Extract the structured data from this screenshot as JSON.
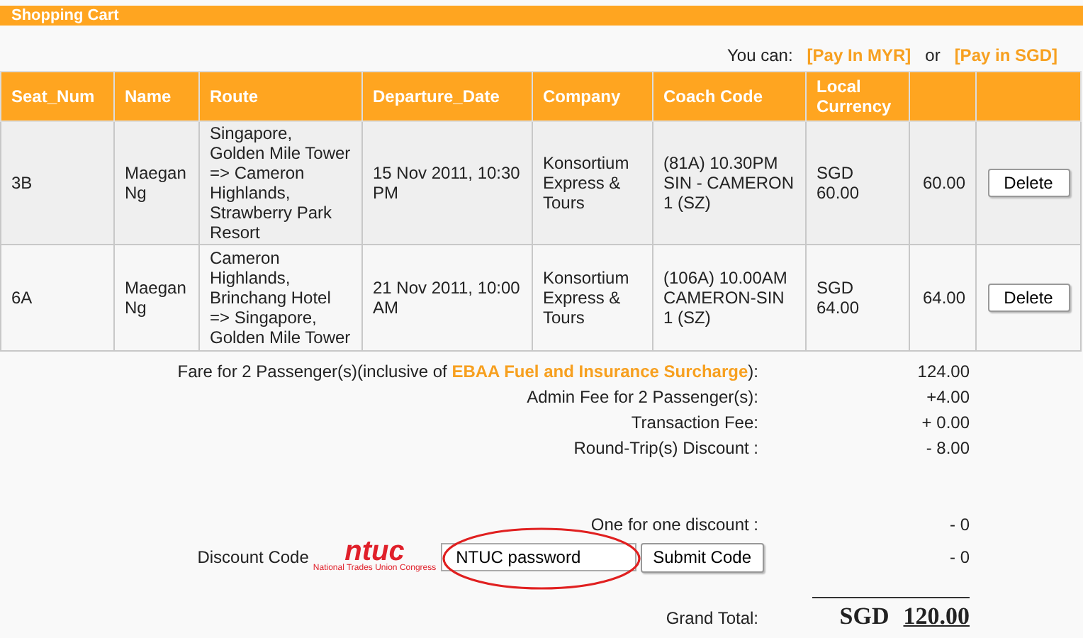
{
  "header": {
    "title": "Shopping Cart"
  },
  "pay_options": {
    "prompt": "You can:",
    "links": [
      "[Pay In MYR]",
      "[Pay in SGD]"
    ],
    "separator": "or"
  },
  "table": {
    "columns": [
      "Seat_Num",
      "Name",
      "Route",
      "Departure_Date",
      "Company",
      "Coach Code",
      "Local Currency"
    ],
    "rows": [
      {
        "seat": "3B",
        "name": "Maegan Ng",
        "route": "Singapore, Golden Mile Tower => Cameron Highlands, Strawberry Park Resort",
        "departure": "15 Nov 2011, 10:30 PM",
        "company": "Konsortium Express & Tours",
        "coach_code": "(81A) 10.30PM SIN - CAMERON 1 (SZ)",
        "local_currency": "SGD 60.00",
        "amount": "60.00",
        "action": "Delete"
      },
      {
        "seat": "6A",
        "name": "Maegan Ng",
        "route": "Cameron Highlands, Brinchang Hotel => Singapore, Golden Mile Tower",
        "departure": "21 Nov 2011, 10:00 AM",
        "company": "Konsortium Express & Tours",
        "coach_code": "(106A) 10.00AM CAMERON-SIN 1 (SZ)",
        "local_currency": "SGD 64.00",
        "amount": "64.00",
        "action": "Delete"
      }
    ]
  },
  "fare": {
    "prefix": "Fare for 2 Passenger(s)(inclusive of ",
    "link": "EBAA Fuel and Insurance Surcharge",
    "suffix": "):",
    "value": "124.00"
  },
  "charges": [
    {
      "label": "Admin Fee for 2 Passenger(s):",
      "value": "+4.00"
    },
    {
      "label": "Transaction Fee:",
      "value": "+ 0.00"
    },
    {
      "label": "Round-Trip(s) Discount :",
      "value": "- 8.00"
    }
  ],
  "one_for_one": {
    "label": "One for one discount :",
    "value": "- 0"
  },
  "discount_code": {
    "label": "Discount Code",
    "logo_text": "ntuc",
    "logo_tagline": "National Trades Union Congress",
    "input_value": "NTUC password",
    "button": "Submit Code",
    "value": "- 0"
  },
  "grand_total": {
    "label": "Grand Total:",
    "currency": "SGD",
    "amount": "120.00"
  }
}
